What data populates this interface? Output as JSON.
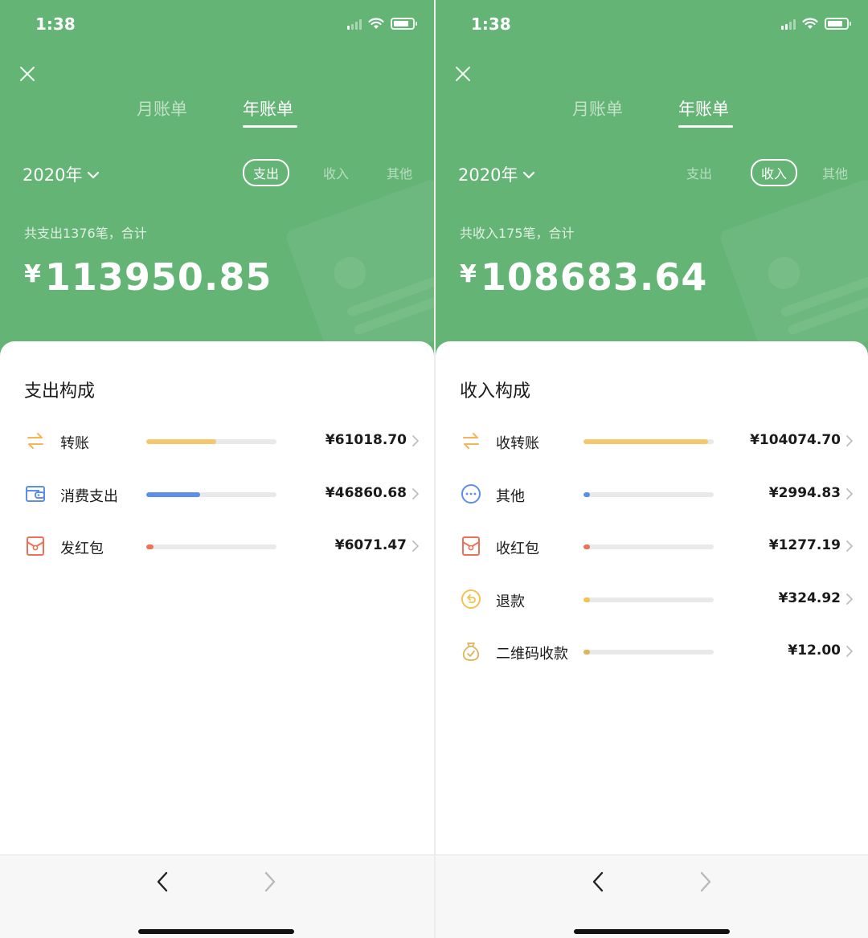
{
  "status_bar": {
    "time": "1:38"
  },
  "accent_color": "#64b476",
  "screens": [
    {
      "tabs": [
        {
          "label": "月账单",
          "active": false
        },
        {
          "label": "年账单",
          "active": true
        }
      ],
      "year": "2020年",
      "filters": [
        {
          "label": "支出",
          "active": true
        },
        {
          "label": "收入",
          "active": false
        },
        {
          "label": "其他",
          "active": false
        }
      ],
      "summary_label": "共支出1376笔，合计",
      "total_currency": "¥",
      "total_amount": "113950.85",
      "section_title": "支出构成",
      "items": [
        {
          "icon": "transfer-icon",
          "label": "转账",
          "amount": "¥61018.70",
          "progress": 0.535,
          "color": "#f5c66a"
        },
        {
          "icon": "wallet-icon",
          "label": "消费支出",
          "amount": "¥46860.68",
          "progress": 0.411,
          "color": "#5b8fe8"
        },
        {
          "icon": "red-packet-icon",
          "label": "发红包",
          "amount": "¥6071.47",
          "progress": 0.053,
          "color": "#ee7055"
        }
      ]
    },
    {
      "tabs": [
        {
          "label": "月账单",
          "active": false
        },
        {
          "label": "年账单",
          "active": true
        }
      ],
      "year": "2020年",
      "filters": [
        {
          "label": "支出",
          "active": false
        },
        {
          "label": "收入",
          "active": true
        },
        {
          "label": "其他",
          "active": false
        }
      ],
      "summary_label": "共收入175笔，合计",
      "total_currency": "¥",
      "total_amount": "108683.64",
      "section_title": "收入构成",
      "items": [
        {
          "icon": "transfer-icon",
          "label": "收转账",
          "amount": "¥104074.70",
          "progress": 0.958,
          "color": "#f5c66a"
        },
        {
          "icon": "more-circle-icon",
          "label": "其他",
          "amount": "¥2994.83",
          "progress": 0.028,
          "color": "#5b8fe8"
        },
        {
          "icon": "red-packet-icon",
          "label": "收红包",
          "amount": "¥1277.19",
          "progress": 0.012,
          "color": "#ee7055"
        },
        {
          "icon": "refund-icon",
          "label": "退款",
          "amount": "¥324.92",
          "progress": 0.003,
          "color": "#f3c24f"
        },
        {
          "icon": "qr-money-bag-icon",
          "label": "二维码收款",
          "amount": "¥12.00",
          "progress": 0.0001,
          "color": "#e0b45a"
        }
      ]
    }
  ]
}
